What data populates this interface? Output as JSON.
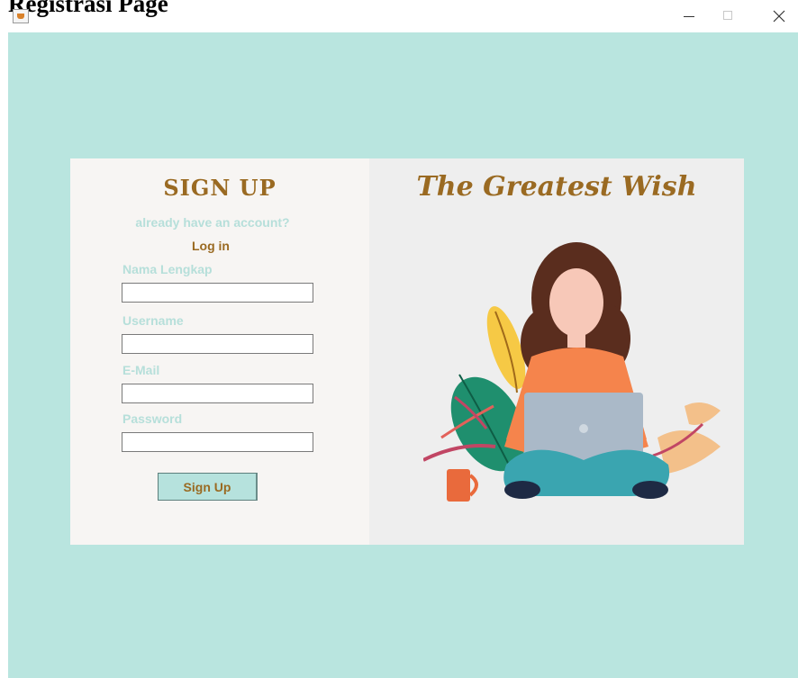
{
  "window": {
    "heading": "Registrasi Page"
  },
  "signup_panel": {
    "title": "SIGN UP",
    "already_text": "already have an account?",
    "login_link": "Log in",
    "fields": [
      {
        "label": "Nama Lengkap",
        "value": ""
      },
      {
        "label": "Username",
        "value": ""
      },
      {
        "label": "E-Mail",
        "value": ""
      },
      {
        "label": "Password",
        "value": ""
      }
    ],
    "signup_button": "Sign Up"
  },
  "banner": {
    "title": "The Greatest Wish"
  },
  "colors": {
    "background": "#b9e5df",
    "accent": "#9a6a22",
    "label": "#b6dfda"
  }
}
